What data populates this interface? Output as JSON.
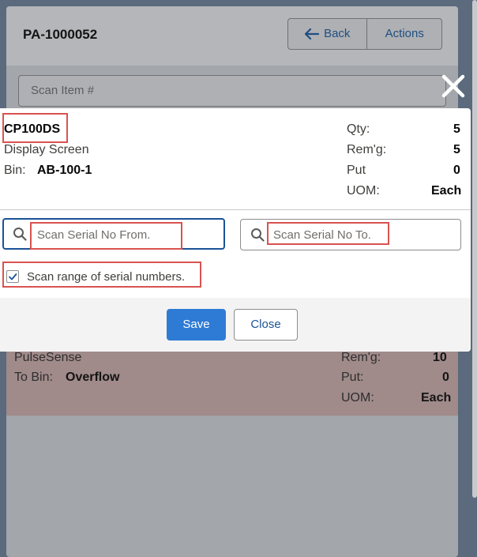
{
  "header": {
    "title": "PA-1000052",
    "back_label": "Back",
    "actions_label": "Actions",
    "back_icon": "arrow-left-icon"
  },
  "scan_item": {
    "placeholder": "Scan Item #"
  },
  "background_row": {
    "description": "PulseSense",
    "to_bin_label": "To Bin:",
    "to_bin_value": "Overflow",
    "remg_label": "Rem'g:",
    "remg_value": "10",
    "put_label": "Put:",
    "put_value": "0",
    "uom_label": "UOM:",
    "uom_value": "Each"
  },
  "modal": {
    "item_code": "CP100DS",
    "item_description": "Display Screen",
    "bin_label": "Bin:",
    "bin_value": "AB-100-1",
    "qty_label": "Qty:",
    "qty_value": "5",
    "remg_label": "Rem'g:",
    "remg_value": "5",
    "put_label": "Put",
    "put_value": "0",
    "uom_label": "UOM:",
    "uom_value": "Each",
    "serial_from_placeholder": "Scan Serial No From.",
    "serial_to_placeholder": "Scan Serial No To.",
    "range_checkbox_label": "Scan range of serial numbers.",
    "range_checked": true,
    "save_label": "Save",
    "close_label": "Close"
  },
  "colors": {
    "accent": "#2e7bd5",
    "focus_border": "#1b5297",
    "highlight_box": "#d9534f"
  }
}
